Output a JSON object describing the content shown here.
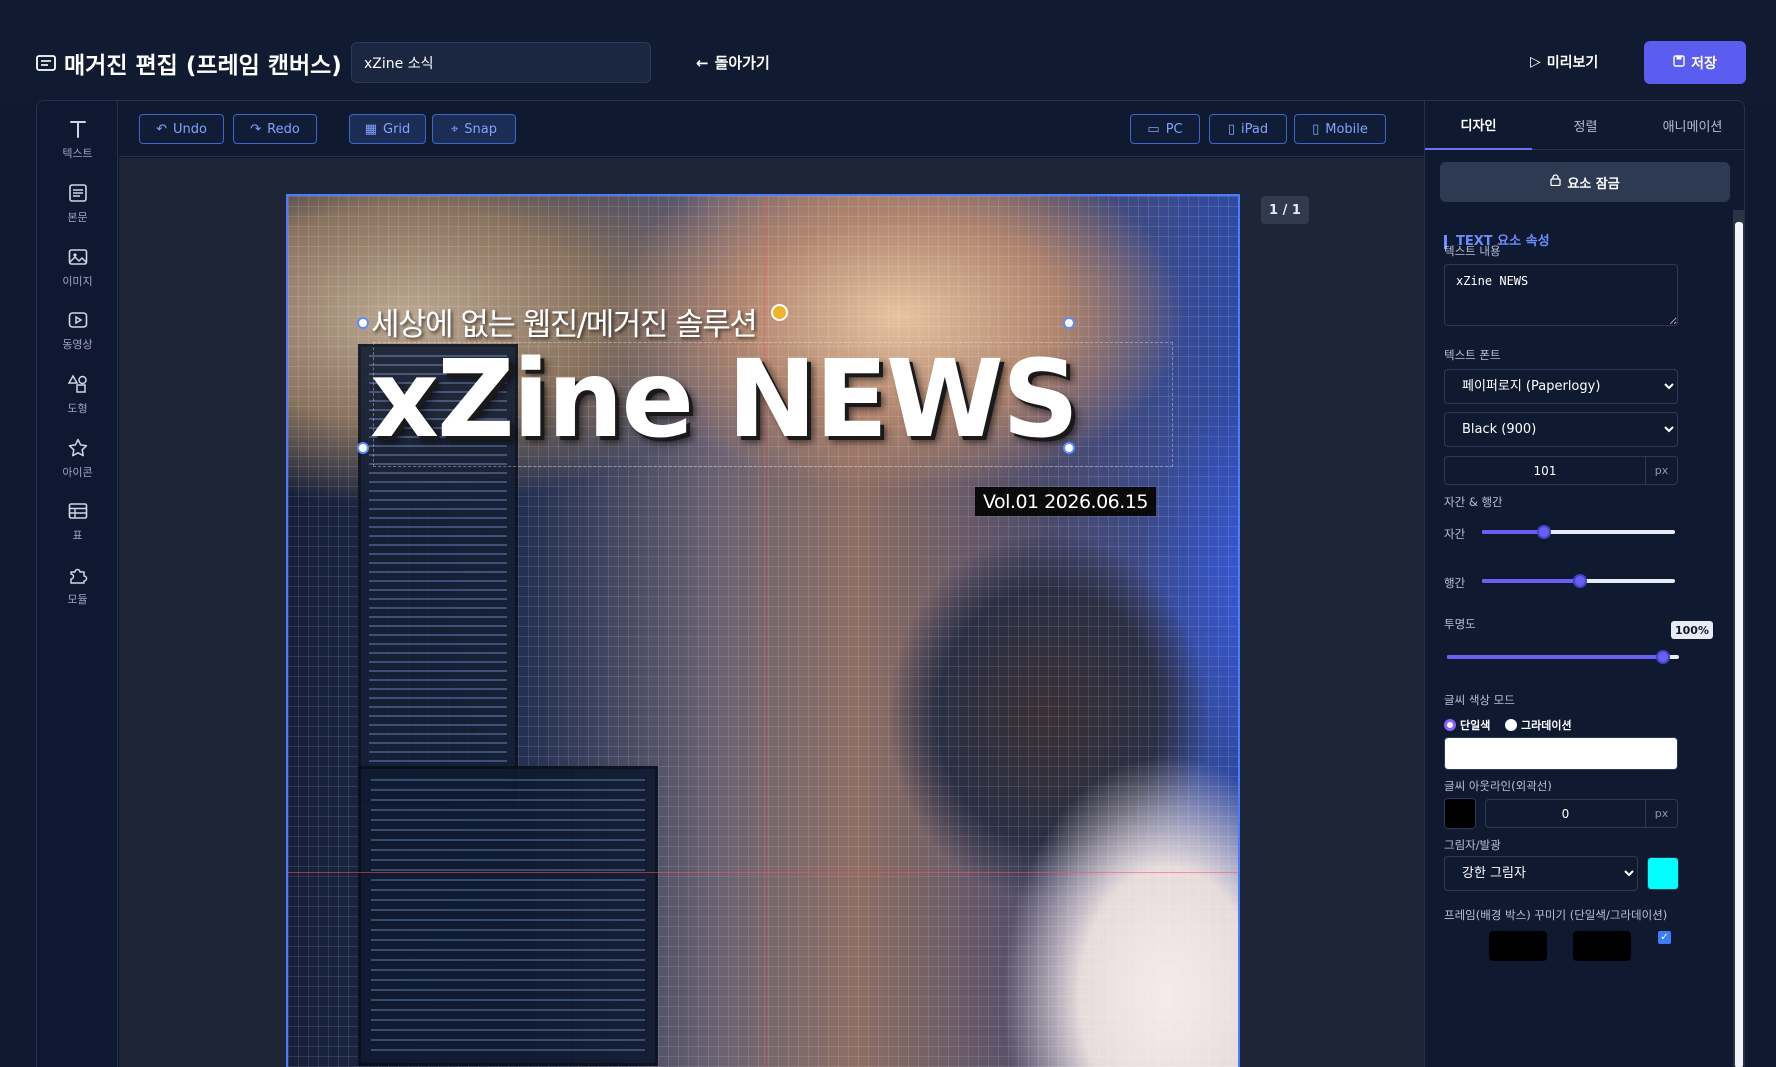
{
  "header": {
    "title": "매거진 편집 (프레임 캔버스)",
    "name_value": "xZine 소식",
    "back_label": "돌아가기",
    "preview_label": "미리보기",
    "save_label": "저장"
  },
  "tools": [
    {
      "label": "텍스트",
      "icon": "text-icon"
    },
    {
      "label": "본문",
      "icon": "paragraph-icon"
    },
    {
      "label": "이미지",
      "icon": "image-icon"
    },
    {
      "label": "동영상",
      "icon": "video-icon"
    },
    {
      "label": "도형",
      "icon": "shapes-icon"
    },
    {
      "label": "아이콘",
      "icon": "star-icon"
    },
    {
      "label": "표",
      "icon": "table-icon"
    },
    {
      "label": "모듈",
      "icon": "puzzle-icon"
    }
  ],
  "toolbar": {
    "undo": "Undo",
    "redo": "Redo",
    "grid": "Grid",
    "snap": "Snap",
    "pc": "PC",
    "ipad": "iPad",
    "mobile": "Mobile"
  },
  "canvas": {
    "page_indicator": "1 / 1",
    "subtitle": "세상에 없는 웹진/메거진 솔루션",
    "headline": "xZine NEWS",
    "vol": "Vol.01 2026.06.15"
  },
  "panel": {
    "tabs": [
      "디자인",
      "정렬",
      "애니메이션"
    ],
    "lock_label": "요소 잠금",
    "section_title": "TEXT 요소 속성",
    "text_content_label": "텍스트 내용",
    "text_content_value": "xZine NEWS",
    "font_label": "텍스트 폰트",
    "font_family": "페이퍼로지 (Paperlogy)",
    "font_weight": "Black (900)",
    "font_size": "101",
    "font_size_unit": "px",
    "spacing_label": "자간 & 행간",
    "letter_spacing_label": "자간",
    "letter_spacing_fraction": 0.32,
    "line_height_label": "행간",
    "line_height_fraction": 0.51,
    "opacity_label": "투명도",
    "opacity_value": "100%",
    "opacity_fraction": 0.93,
    "color_mode_label": "글씨 색상 모드",
    "color_mode_options": [
      "단일색",
      "그라데이션"
    ],
    "color_mode_selected": "단일색",
    "text_color": "#ffffff",
    "outline_label": "글씨 아웃라인(외곽선)",
    "outline_color": "#000000",
    "outline_width": "0",
    "outline_unit": "px",
    "shadow_label": "그림자/발광",
    "shadow_value": "강한 그림자",
    "shadow_color": "#00ffff",
    "frame_label": "프레임(배경 박스) 꾸미기 (단일색/그라데이션)",
    "frame_checkbox": "✓"
  },
  "colors": {
    "accent": "#5b5cf0",
    "toolbar_border": "#3a67c8",
    "background": "#0f1a30"
  }
}
